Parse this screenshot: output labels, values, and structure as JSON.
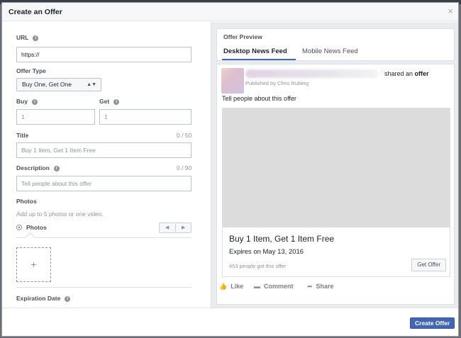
{
  "modal": {
    "title": "Create an Offer",
    "close_glyph": "×"
  },
  "form": {
    "url_label": "URL",
    "url_value": "https://",
    "offer_type_label": "Offer Type",
    "offer_type_value": "Buy One, Get One",
    "offer_type_arrows": "▲▼",
    "buy_label": "Buy",
    "buy_placeholder": "1",
    "get_label": "Get",
    "get_placeholder": "1",
    "title_label": "Title",
    "title_counter": "0 / 50",
    "title_placeholder": "Buy 1 Item, Get 1 Item Free",
    "description_label": "Description",
    "description_counter": "0 / 90",
    "description_placeholder": "Tell people about this offer",
    "photos_label": "Photos",
    "photos_hint": "Add up to 5 photos or one video.",
    "photos_radio_label": "Photos",
    "pager_prev": "◀",
    "pager_next": "▶",
    "upload_glyph": "+",
    "expiration_label": "Expiration Date",
    "info_glyph": "i"
  },
  "preview": {
    "title": "Offer Preview",
    "tabs": [
      {
        "label": "Desktop News Feed",
        "active": true
      },
      {
        "label": "Mobile News Feed",
        "active": false
      }
    ],
    "post": {
      "shared_prefix": "shared an",
      "shared_object": "offer",
      "published_by": "Published by Chris Ruberg",
      "body": "Tell people about this offer",
      "offer_title": "Buy 1 Item, Get 1 Item Free",
      "offer_expires": "Expires on May 13, 2016",
      "offer_count": "453 people got this offer",
      "get_offer_label": "Get Offer"
    },
    "actions": [
      {
        "label": "Like",
        "icon": "thumbs-up-icon",
        "glyph": "👍"
      },
      {
        "label": "Comment",
        "icon": "comment-icon",
        "glyph": "▬"
      },
      {
        "label": "Share",
        "icon": "share-icon",
        "glyph": "➦"
      }
    ]
  },
  "footer": {
    "create_label": "Create Offer"
  },
  "colors": {
    "accent": "#4267b2",
    "image_placeholder": "#dcdcdc"
  }
}
